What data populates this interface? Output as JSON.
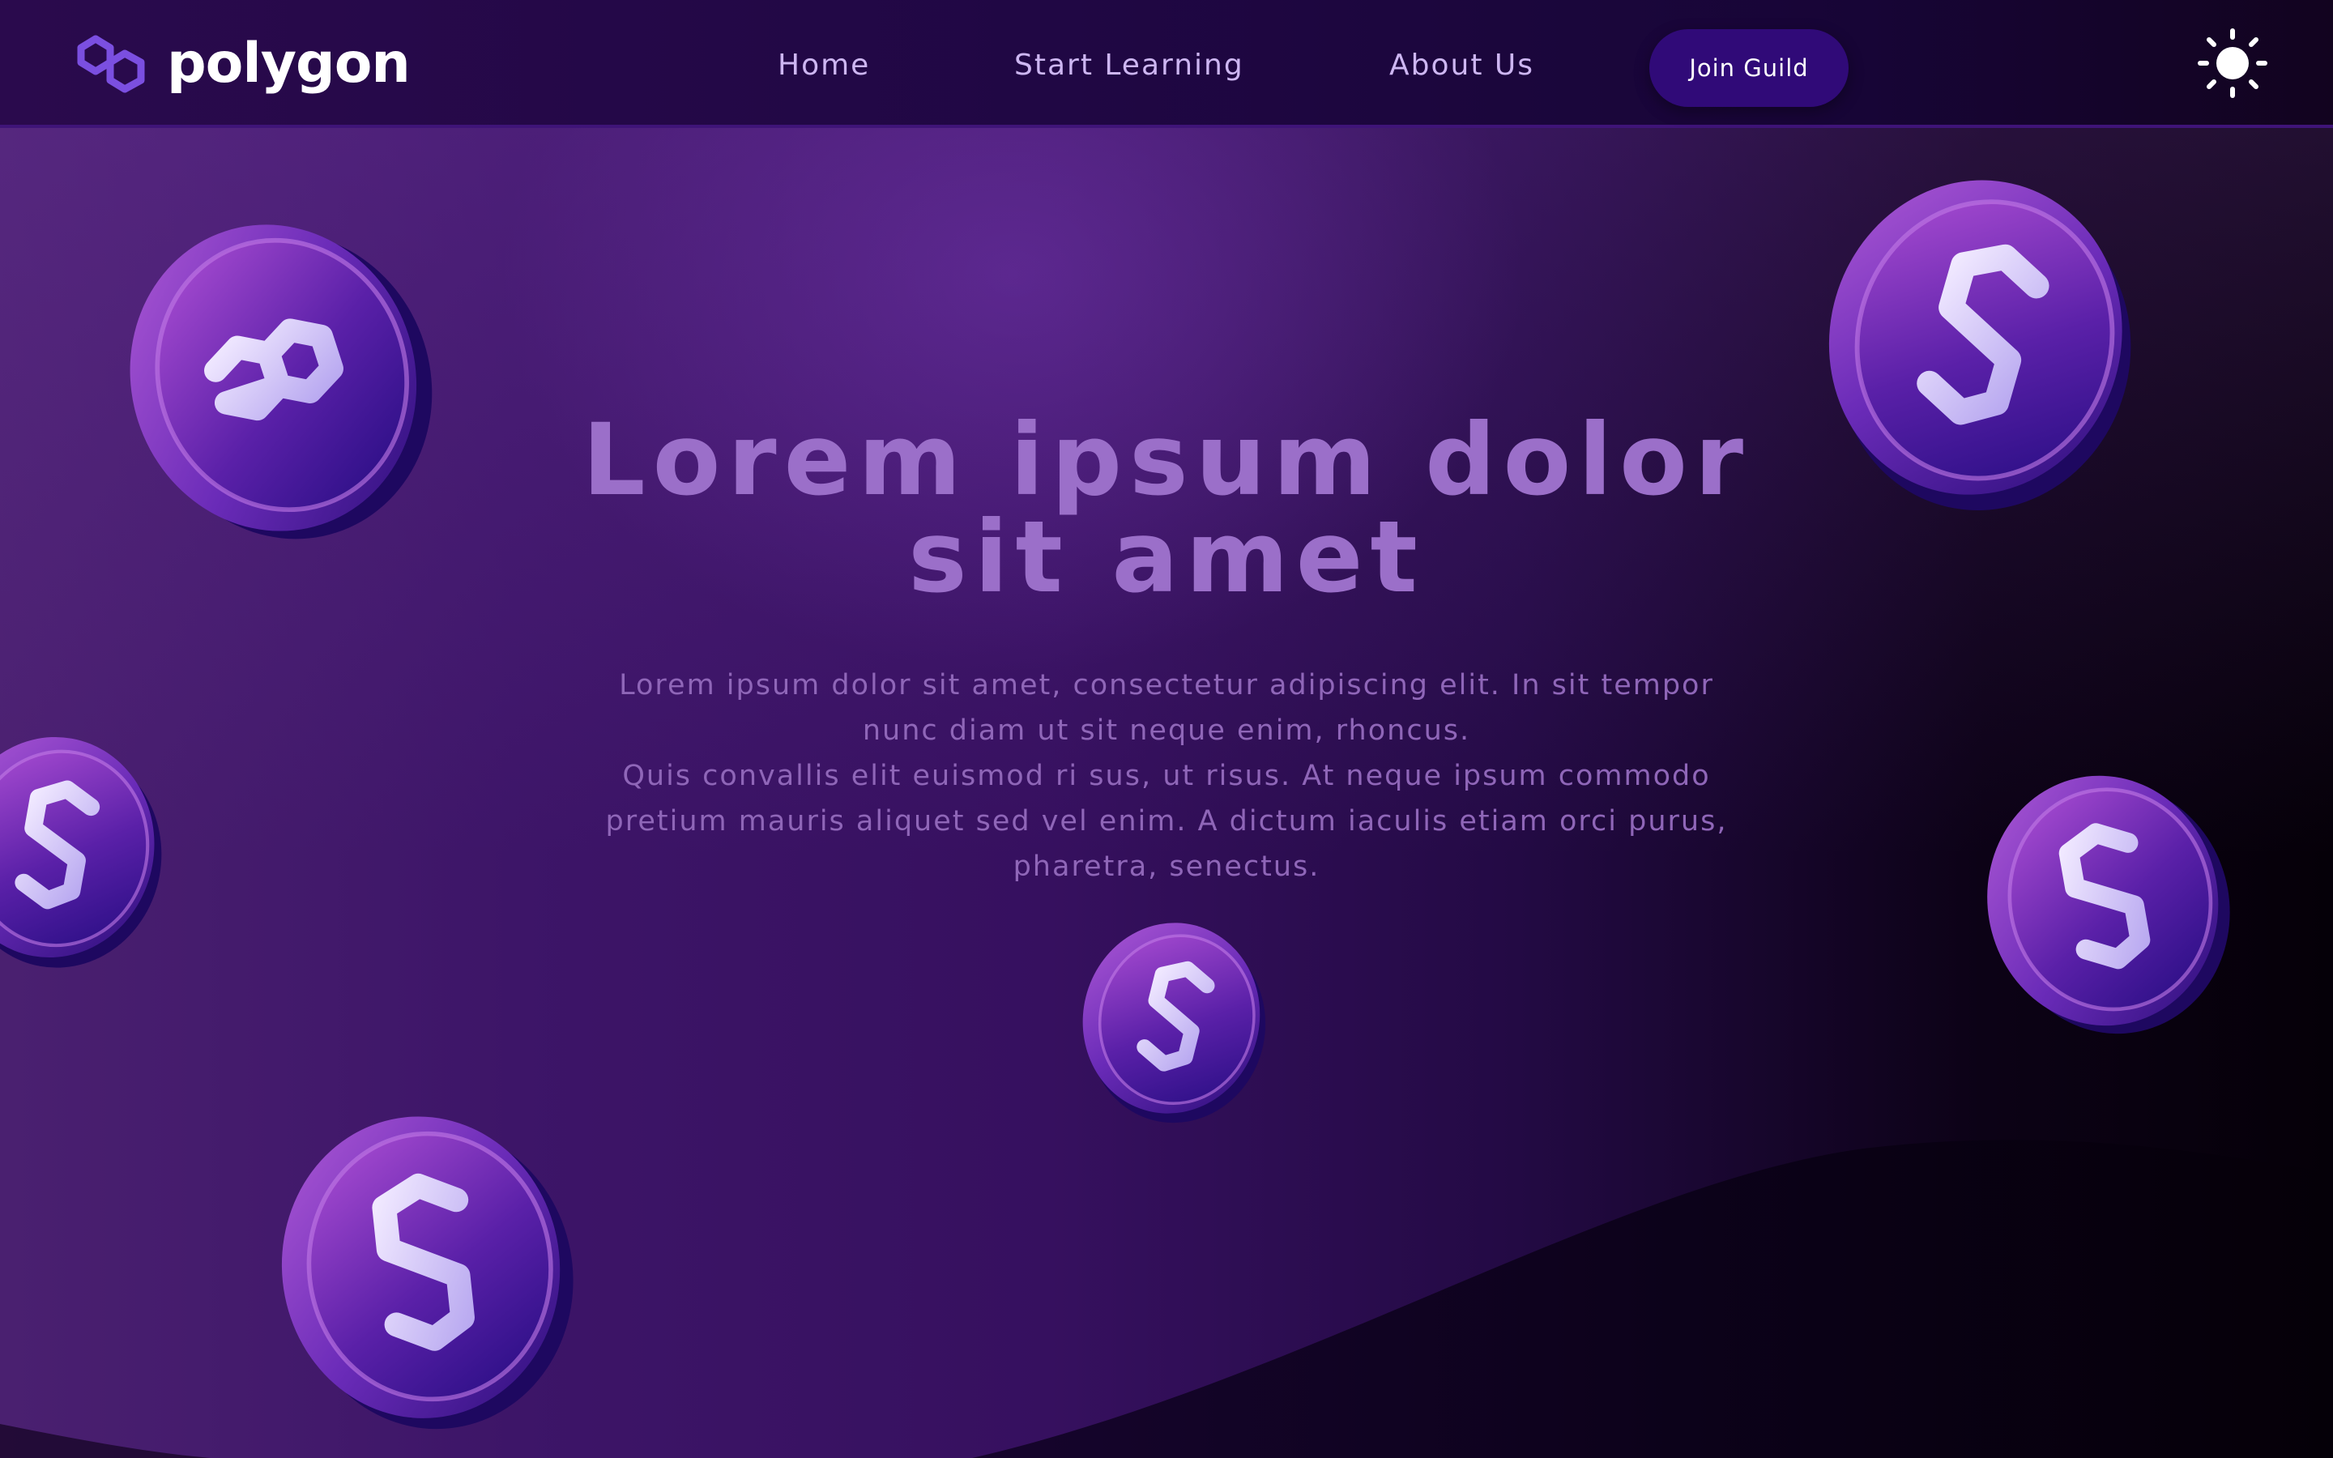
{
  "brand": {
    "name": "polygon",
    "logo_icon": "polygon-hexagon-logo-icon",
    "accent_color": "#7b4fe0"
  },
  "nav": {
    "items": [
      {
        "label": "Home"
      },
      {
        "label": "Start Learning"
      },
      {
        "label": "About Us"
      }
    ],
    "cta_label": "Join Guild",
    "theme_toggle_icon": "sun-icon"
  },
  "hero": {
    "title": "Lorem ipsum dolor sit amet",
    "paragraph_1": "Lorem ipsum dolor sit amet, consectetur adipiscing elit. In sit tempor nunc diam ut sit neque enim, rhoncus.",
    "paragraph_2": "Quis convallis elit euismod ri sus, ut risus. At neque ipsum commodo pretium mauris aliquet sed vel enim. A dictum iaculis etiam orci purus, pharetra, senectus.",
    "decoration_icon": "polygon-coin-icon"
  },
  "colors": {
    "header_bg": "#200744",
    "cta_bg": "#300a78",
    "title_text": "#9b6fc9",
    "body_text": "#8f66b8",
    "nav_text": "#cdb6f2"
  }
}
